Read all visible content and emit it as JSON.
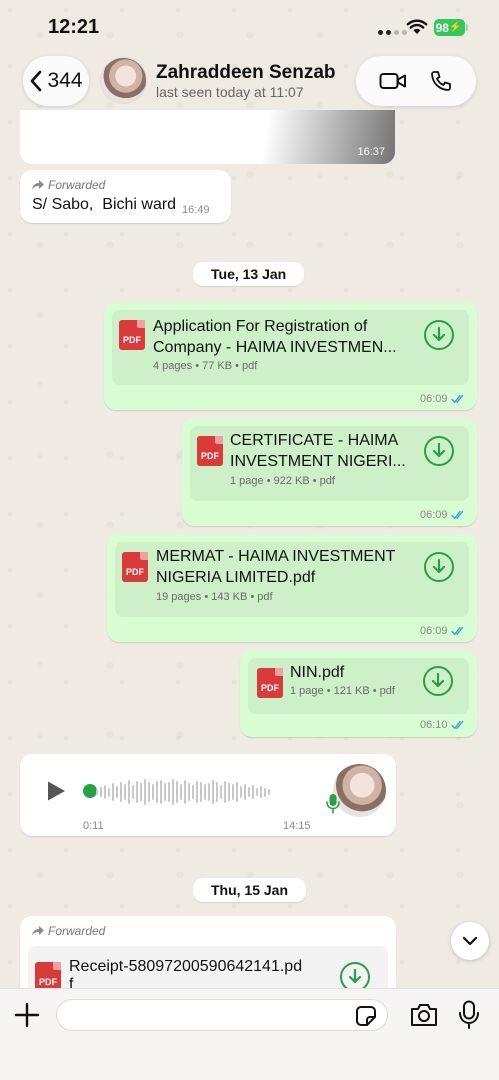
{
  "status_bar": {
    "time": "12:21",
    "battery": "98"
  },
  "header": {
    "back_count": "344",
    "contact_name": "Zahraddeen Senzab",
    "contact_status": "last seen today at 11:07"
  },
  "messages": {
    "photo_time": "16:37",
    "forwarded_1": {
      "label": "Forwarded",
      "text": "S/ Sabo,  Bichi ward",
      "time": "16:49"
    },
    "date_1": "Tue, 13 Jan",
    "docs": [
      {
        "title_line1": "Application For Registration of",
        "title_line2": "Company - HAIMA INVESTMEN...",
        "meta": "4 pages • 77 KB • pdf",
        "time": "06:09",
        "icon": "PDF"
      },
      {
        "title_line1": "CERTIFICATE - HAIMA",
        "title_line2": "INVESTMENT NIGERI...",
        "meta": "1 page • 922 KB • pdf",
        "time": "06:09",
        "icon": "PDF"
      },
      {
        "title_line1": "MERMAT - HAIMA INVESTMENT",
        "title_line2": "NIGERIA LIMITED.pdf",
        "meta": "19 pages • 143 KB • pdf",
        "time": "06:09",
        "icon": "PDF"
      },
      {
        "title_line1": "NIN.pdf",
        "title_line2": "",
        "meta": "1 page • 121 KB • pdf",
        "time": "06:10",
        "icon": "PDF"
      }
    ],
    "voice": {
      "elapsed": "0:11",
      "time": "14:15"
    },
    "date_2": "Thu, 15 Jan",
    "forwarded_2": {
      "label": "Forwarded",
      "doc_title": "Receipt-58097200590642141.pd",
      "doc_title_cont": "f",
      "icon": "PDF"
    }
  },
  "composer": {
    "placeholder": ""
  },
  "colors": {
    "accent": "#25a244",
    "outgoing": "#d9fdd3",
    "read_ticks": "#34a3e6"
  },
  "icons": [
    "back-chevron-icon",
    "video-call-icon",
    "phone-icon",
    "forward-arrow-icon",
    "download-icon",
    "double-tick-icon",
    "play-icon",
    "mic-icon",
    "chevron-down-icon",
    "plus-icon",
    "sticker-icon",
    "camera-icon"
  ]
}
